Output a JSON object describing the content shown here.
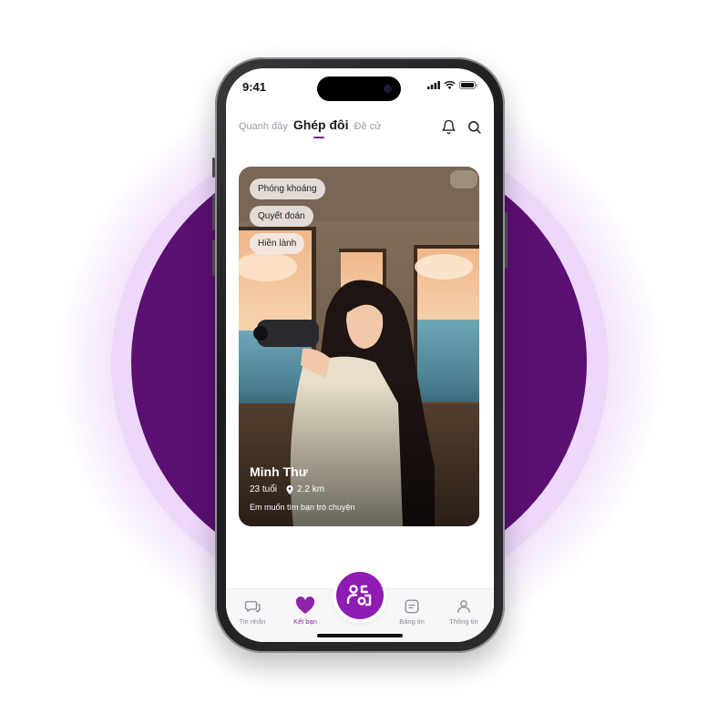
{
  "status_bar": {
    "time": "9:41"
  },
  "top_tabs": {
    "nearby": "Quanh đây",
    "matching": "Ghép đôi",
    "suggest": "Đề cử"
  },
  "card": {
    "tags": [
      "Phóng khoáng",
      "Quyết đoán",
      "Hiền lành"
    ],
    "name": "Minh Thư",
    "age": "23 tuổi",
    "distance": "2.2 km",
    "bio": "Em muốn tìm bạn trò chuyện"
  },
  "bottom_nav": {
    "messages": "Tin nhắn",
    "friends": "Kết bạn",
    "board": "Bảng tin",
    "profile": "Thông tin"
  },
  "colors": {
    "accent": "#8e24aa",
    "circle_bg": "#5c0f73"
  },
  "icons": [
    "bell-icon",
    "search-icon",
    "location-pin-icon",
    "chat-icon",
    "heart-icon",
    "match-icon",
    "board-icon",
    "user-icon"
  ]
}
